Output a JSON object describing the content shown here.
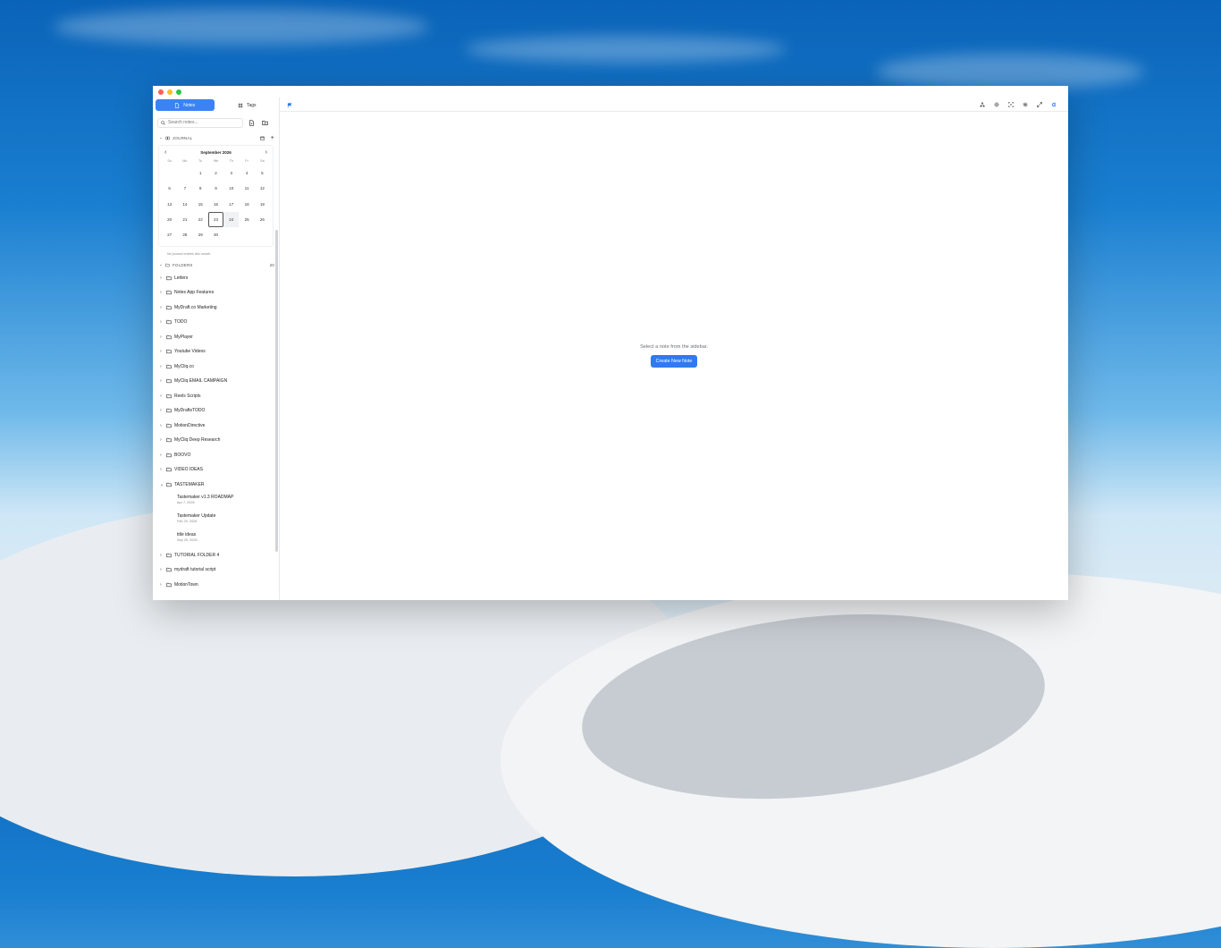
{
  "sidebar": {
    "tabs": [
      {
        "label": "Notes"
      },
      {
        "label": "Tags"
      }
    ],
    "search": {
      "placeholder": "Search notes..."
    },
    "journal": {
      "label": "JOURNAL",
      "empty": "No journal entries this month"
    },
    "calendar": {
      "month_label": "September 2026",
      "dow": [
        "Su",
        "Mo",
        "Tu",
        "We",
        "Th",
        "Fr",
        "Sa"
      ],
      "weeks": [
        [
          "",
          "",
          "1",
          "2",
          "3",
          "4",
          "5"
        ],
        [
          "6",
          "7",
          "8",
          "9",
          "10",
          "11",
          "12"
        ],
        [
          "13",
          "14",
          "15",
          "16",
          "17",
          "18",
          "19"
        ],
        [
          "20",
          "21",
          "22",
          "23",
          "24",
          "25",
          "26"
        ],
        [
          "27",
          "28",
          "29",
          "30",
          "",
          "",
          ""
        ]
      ],
      "today": "23",
      "highlighted": "24"
    },
    "folders_header": {
      "label": "FOLDERS",
      "count": "20"
    },
    "folders": [
      {
        "name": "Letters",
        "open": false
      },
      {
        "name": "Notes App Features",
        "open": false
      },
      {
        "name": "MyDraft.co Marketing",
        "open": false
      },
      {
        "name": "TODO",
        "open": false
      },
      {
        "name": "MyPlayer",
        "open": false
      },
      {
        "name": "Youtube Videos",
        "open": false
      },
      {
        "name": "MyCliq.co",
        "open": false
      },
      {
        "name": "MyCliq EMAIL CAMPAIGN",
        "open": false
      },
      {
        "name": "Reels Scripts",
        "open": false
      },
      {
        "name": "MyDraftsTODO",
        "open": false
      },
      {
        "name": "MotionDirective",
        "open": false
      },
      {
        "name": "MyCliq Deep Research",
        "open": false
      },
      {
        "name": "BOOVO",
        "open": false
      },
      {
        "name": "VIDEO IDEAS",
        "open": false
      },
      {
        "name": "TASTEMAKER",
        "open": true,
        "notes": [
          {
            "title": "Tastemaker v1.3 ROADMAP",
            "date": "Apr 7, 2026"
          },
          {
            "title": "Tastemaker Update",
            "date": "Feb 20, 2026"
          },
          {
            "title": "title ideas",
            "date": "Sep 25, 2025"
          }
        ]
      },
      {
        "name": "TUTORIAL FOLDER 4",
        "open": false
      },
      {
        "name": "mydraft tutorial script",
        "open": false
      },
      {
        "name": "MotionTown",
        "open": false
      }
    ]
  },
  "main": {
    "empty_message": "Select a note from the sidebar.",
    "create_button": "Create New Note"
  },
  "colors": {
    "accent": "#3b82f6",
    "close": "#fe5f57",
    "minimize": "#febc2e",
    "maximize": "#28c840"
  },
  "icons": {
    "toolbar_left": "flag-icon",
    "toolbar_right": [
      "graph-icon",
      "sun-icon",
      "focus-icon",
      "gear-icon",
      "expand-icon",
      "app-logo-icon"
    ]
  }
}
